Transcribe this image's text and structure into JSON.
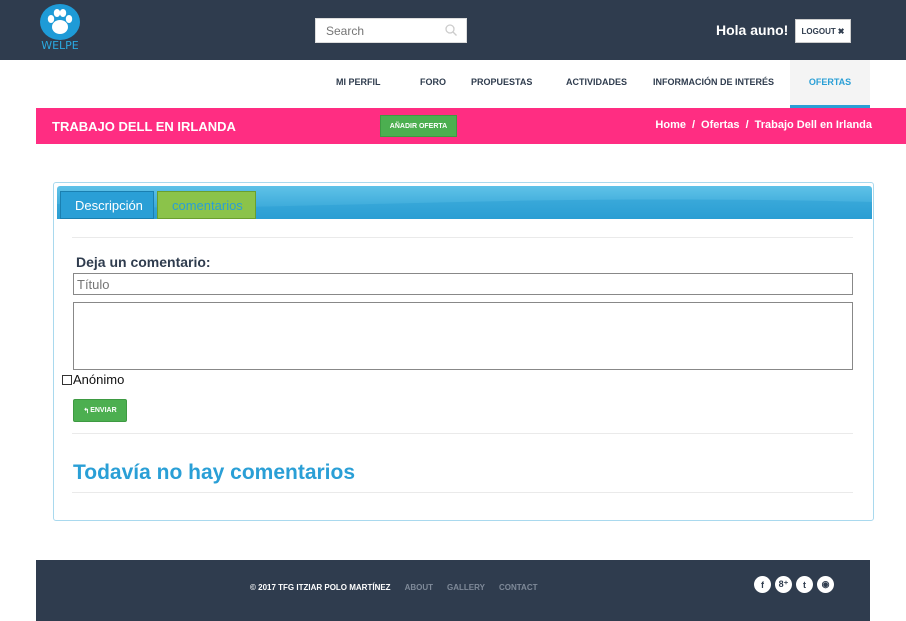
{
  "header": {
    "logo_text": "WELPE",
    "search_placeholder": "Search",
    "greeting": "Hola auno!",
    "logout_label": "LOGOUT"
  },
  "nav": {
    "items": [
      "MI PERFIL",
      "FORO",
      "PROPUESTAS",
      "ACTIVIDADES",
      "INFORMACIÓN DE INTERÉS",
      "OFERTAS"
    ],
    "active": "OFERTAS"
  },
  "titlebar": {
    "title": "TRABAJO DELL EN IRLANDA",
    "add_button": "AÑADIR OFERTA",
    "breadcrumb": [
      "Home",
      "/",
      "Ofertas",
      "/",
      "Trabajo Dell en Irlanda"
    ]
  },
  "tabs": [
    "Descripción",
    "comentarios"
  ],
  "comment_form": {
    "heading": "Deja un comentario:",
    "title_placeholder": "Título",
    "anonymous_label": "Anónimo",
    "send_label": "ENVIAR"
  },
  "empty_message": "Todavía no hay comentarios",
  "footer": {
    "copyright": "© 2017 TFG ITZIAR POLO MARTÍNEZ",
    "links": [
      "ABOUT",
      "GALLERY",
      "CONTACT"
    ],
    "social": [
      "f",
      "8⁺",
      "t",
      "◉"
    ]
  },
  "colors": {
    "header_bg": "#2f3c4e",
    "accent_pink": "#ff2d82",
    "accent_blue": "#2a9fd6",
    "accent_green": "#4caf50"
  },
  "icons": [
    "paw-icon",
    "search-icon",
    "close-icon",
    "reply-icon",
    "facebook-icon",
    "google-plus-icon",
    "twitter-icon",
    "dribbble-icon"
  ]
}
